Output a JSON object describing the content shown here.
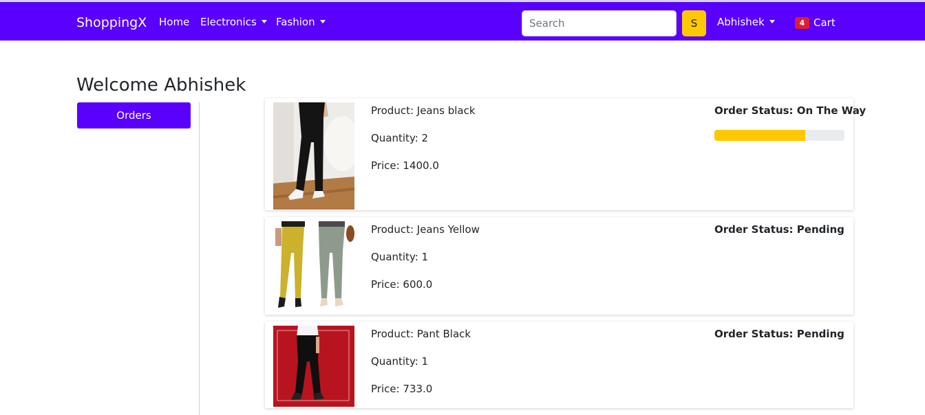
{
  "navbar": {
    "brand": "ShoppingX",
    "links": {
      "home": "Home",
      "electronics": "Electronics",
      "fashion": "Fashion"
    },
    "search_placeholder": "Search",
    "search_button": "S",
    "user": "Abhishek",
    "cart_count": "4",
    "cart_label": "Cart",
    "color": "#5a00ff",
    "accent": "#ffc800"
  },
  "page": {
    "welcome": "Welcome Abhishek",
    "orders_button": "Orders"
  },
  "orders": [
    {
      "product": "Product: Jeans black",
      "quantity": "Quantity: 2",
      "price": "Price: 1400.0",
      "status": "Order Status: On The Way",
      "progress_fraction": 0.7,
      "image": "black-jeans-photo"
    },
    {
      "product": "Product: Jeans Yellow",
      "quantity": "Quantity: 1",
      "price": "Price: 600.0",
      "status": "Order Status: Pending",
      "image": "yellow-grey-trousers-photo"
    },
    {
      "product": "Product: Pant Black",
      "quantity": "Quantity: 1",
      "price": "Price: 733.0",
      "status": "Order Status: Pending",
      "image": "black-pant-red-background-photo"
    }
  ]
}
